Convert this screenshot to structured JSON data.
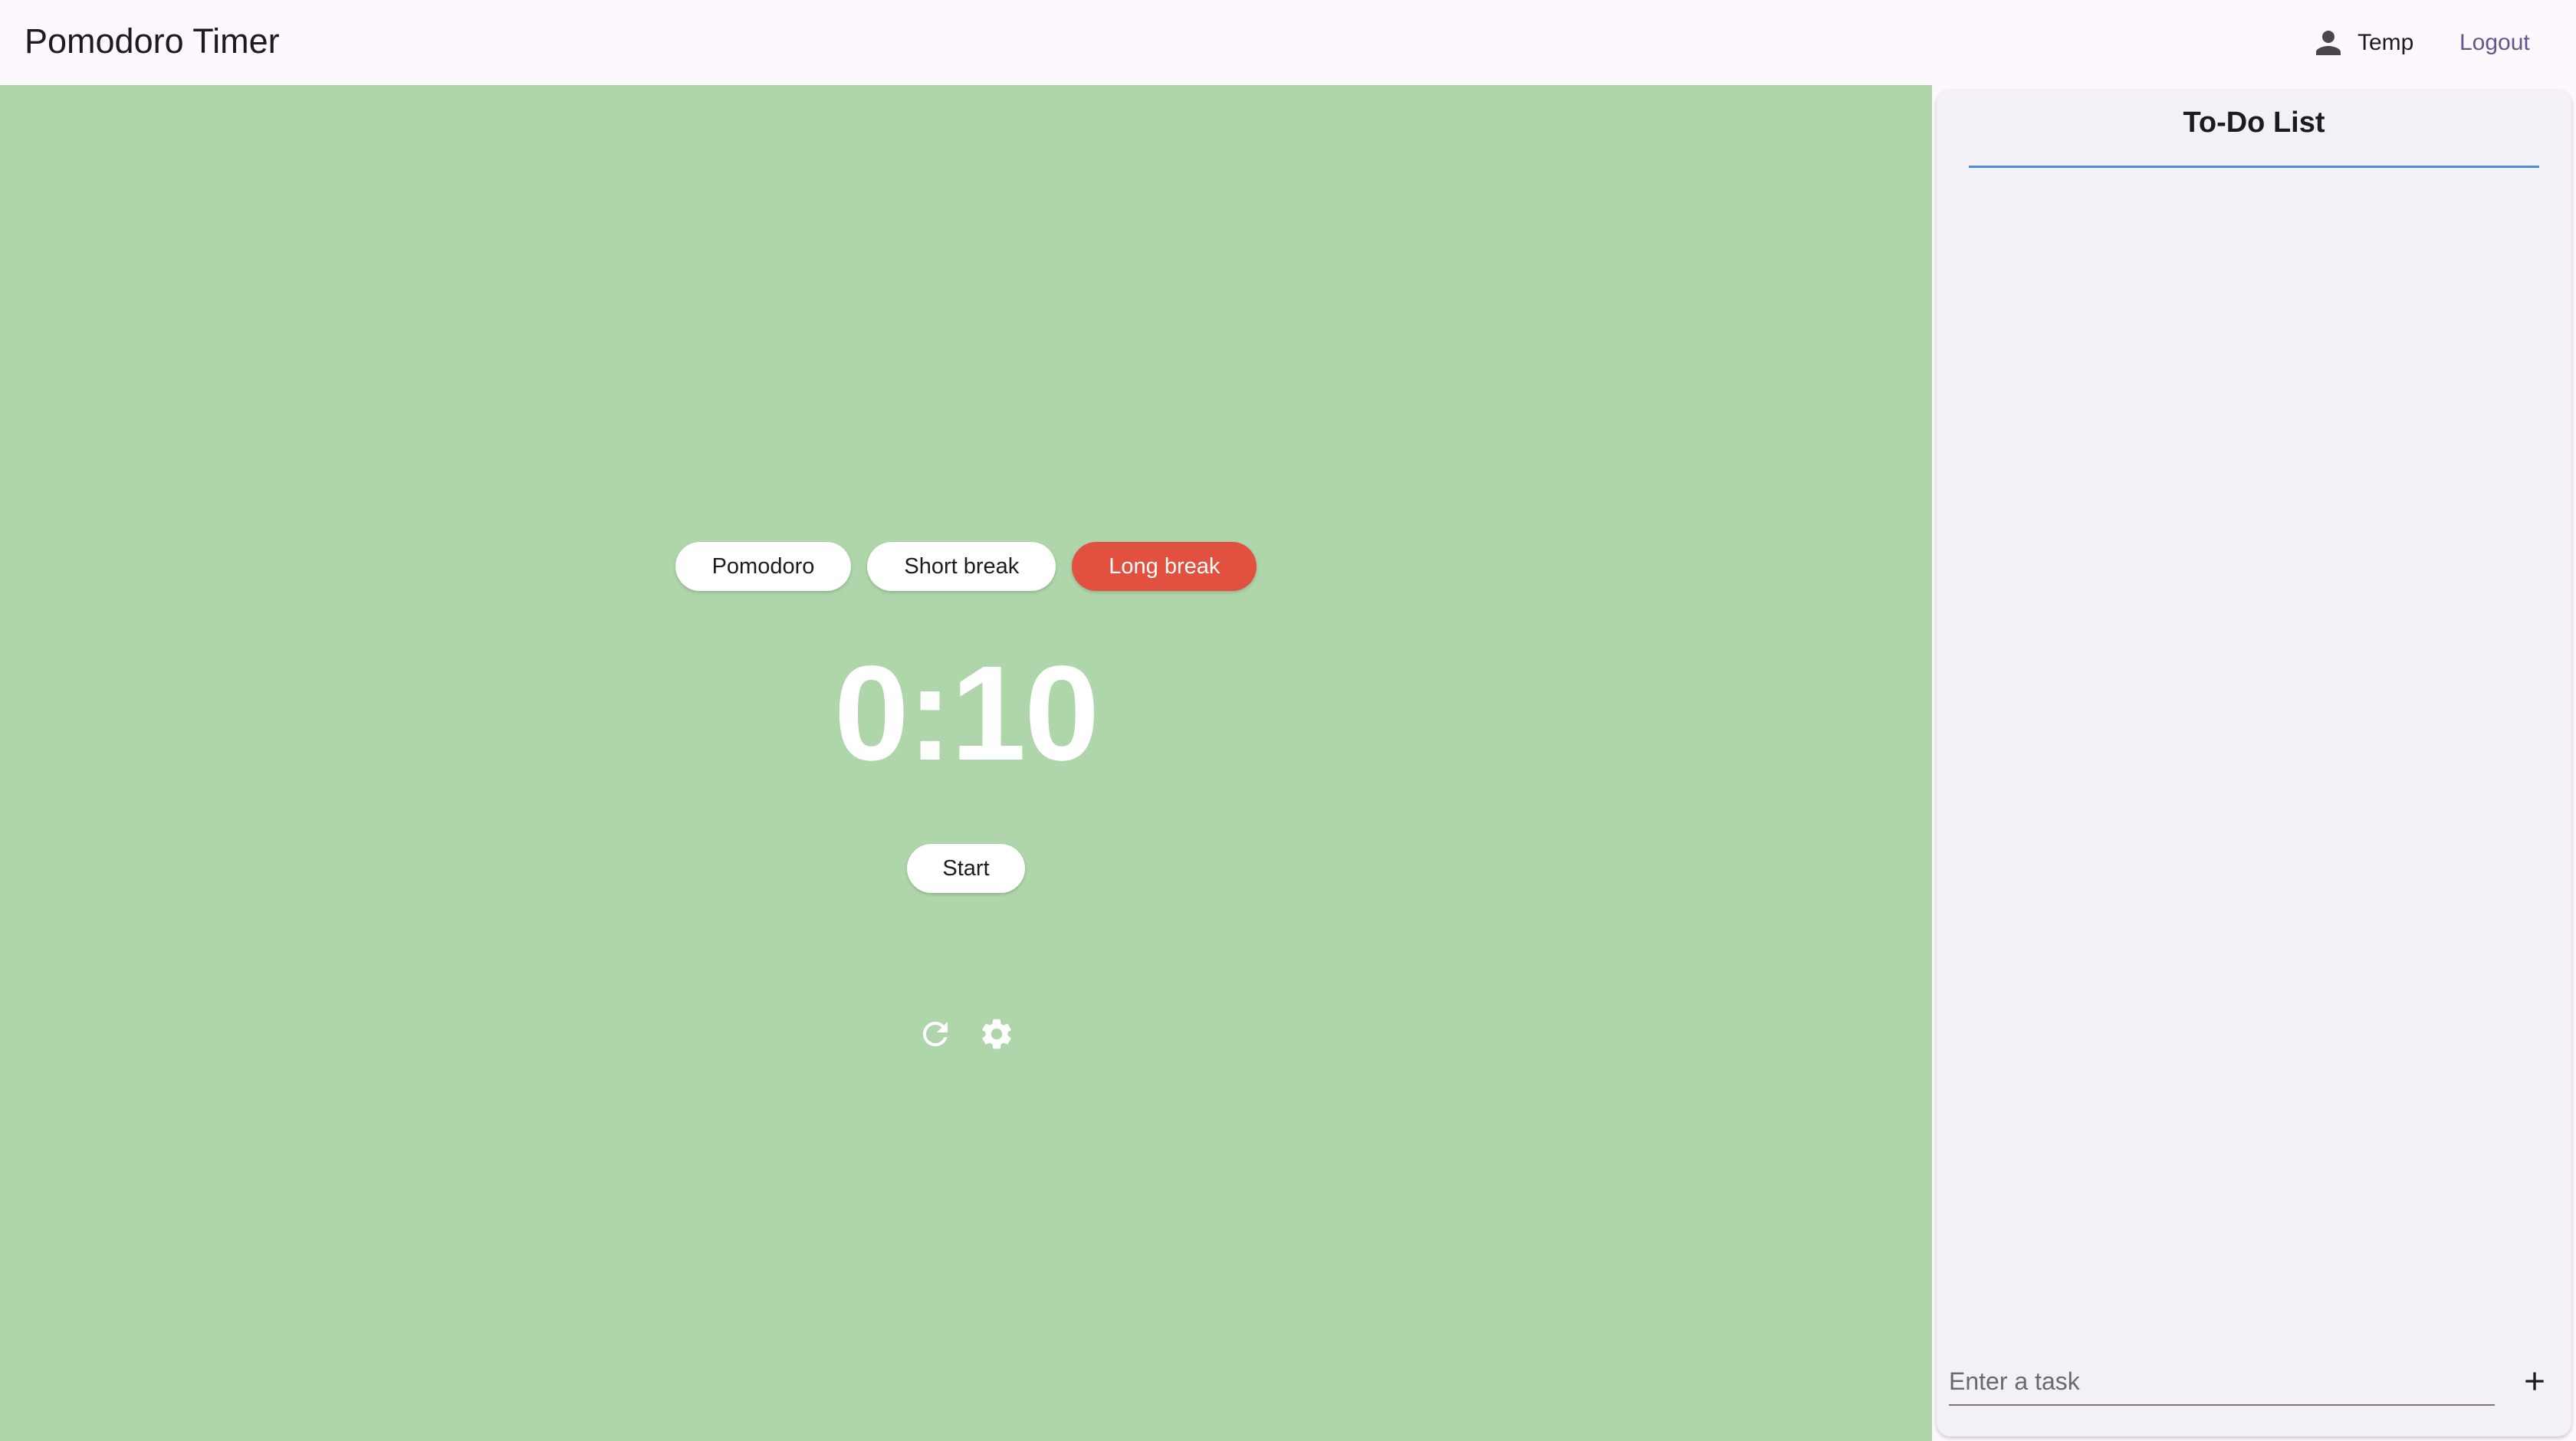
{
  "app": {
    "title": "Pomodoro Timer"
  },
  "header": {
    "user_icon": "person-icon",
    "user_name": "Temp",
    "logout_label": "Logout"
  },
  "timer": {
    "modes": [
      {
        "label": "Pomodoro",
        "active": false
      },
      {
        "label": "Short break",
        "active": false
      },
      {
        "label": "Long break",
        "active": true
      }
    ],
    "time": "0:10",
    "start_label": "Start",
    "reset_icon": "refresh-icon",
    "settings_icon": "gear-icon"
  },
  "todo": {
    "title": "To-Do List",
    "items": [],
    "input_placeholder": "Enter a task",
    "input_value": "",
    "add_icon": "plus-icon"
  },
  "colors": {
    "page_background": "#fdf7fe",
    "timer_background": "#afd6aa",
    "active_mode": "#e2513f",
    "panel_background": "#f3f0f7",
    "accent_line": "#4a90d9",
    "link": "#65558f"
  }
}
